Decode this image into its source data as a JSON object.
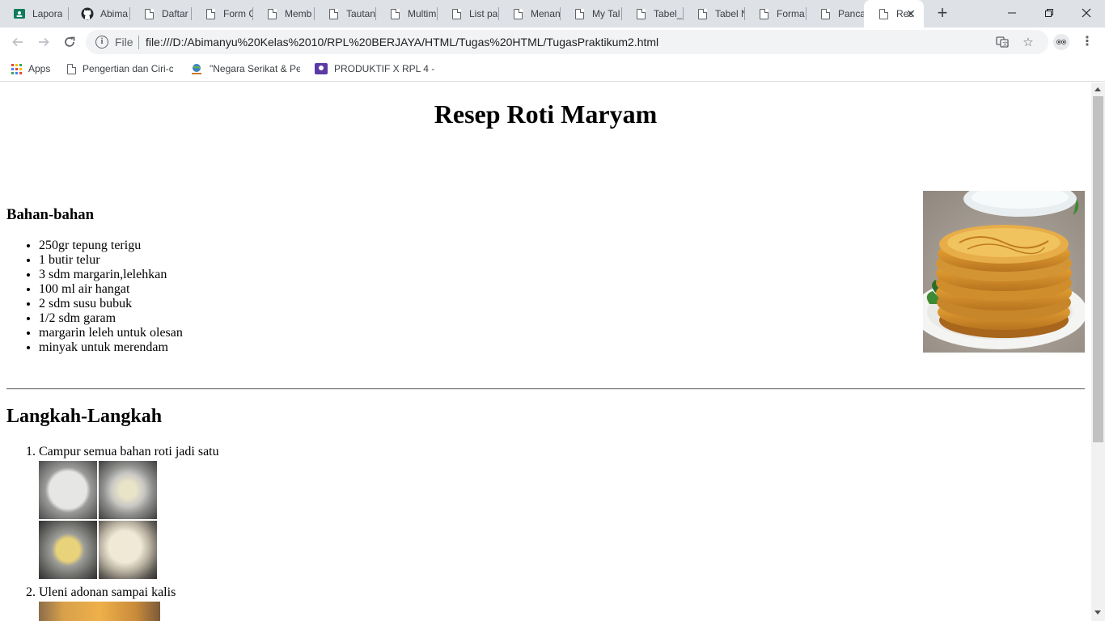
{
  "browser": {
    "tabs": [
      {
        "title": "Lapora",
        "icon": "classroom-icon"
      },
      {
        "title": "Abima",
        "icon": "github-icon"
      },
      {
        "title": "Daftar",
        "icon": "document-icon"
      },
      {
        "title": "Form C",
        "icon": "document-icon"
      },
      {
        "title": "Memb",
        "icon": "document-icon"
      },
      {
        "title": "Tautan",
        "icon": "document-icon"
      },
      {
        "title": "Multim",
        "icon": "document-icon"
      },
      {
        "title": "List pa",
        "icon": "document-icon"
      },
      {
        "title": "Menan",
        "icon": "document-icon"
      },
      {
        "title": "My Tal",
        "icon": "document-icon"
      },
      {
        "title": "Tabel_l",
        "icon": "document-icon"
      },
      {
        "title": "Tabel N",
        "icon": "document-icon"
      },
      {
        "title": "Forma",
        "icon": "document-icon"
      },
      {
        "title": "Pancas",
        "icon": "document-icon"
      },
      {
        "title": "Res",
        "icon": "document-icon",
        "active": true
      }
    ],
    "omnibox": {
      "scheme_label": "File",
      "url": "file:///D:/Abimanyu%20Kelas%2010/RPL%20BERJAYA/HTML/Tugas%20HTML/TugasPraktikum2.html"
    },
    "bookmarks": [
      {
        "label": "Apps",
        "icon": "apps-grid-icon"
      },
      {
        "label": "Pengertian dan Ciri-c",
        "icon": "document-icon"
      },
      {
        "label": "\"Negara Serikat & Pe",
        "icon": "globe-icon"
      },
      {
        "label": "PRODUKTIF X RPL 4 -",
        "icon": "classroom-icon"
      }
    ]
  },
  "page": {
    "title": "Resep Roti Maryam",
    "ingredients_heading": "Bahan-bahan",
    "ingredients": [
      "250gr tepung terigu",
      "1 butir telur",
      "3 sdm margarin,lelehkan",
      "100 ml air hangat",
      "2 sdm susu bubuk",
      "1/2 sdm garam",
      "margarin leleh untuk olesan",
      "minyak untuk merendam"
    ],
    "steps_heading": "Langkah-Langkah",
    "steps": [
      "Campur semua bahan roti jadi satu",
      "Uleni adonan sampai kalis"
    ]
  }
}
